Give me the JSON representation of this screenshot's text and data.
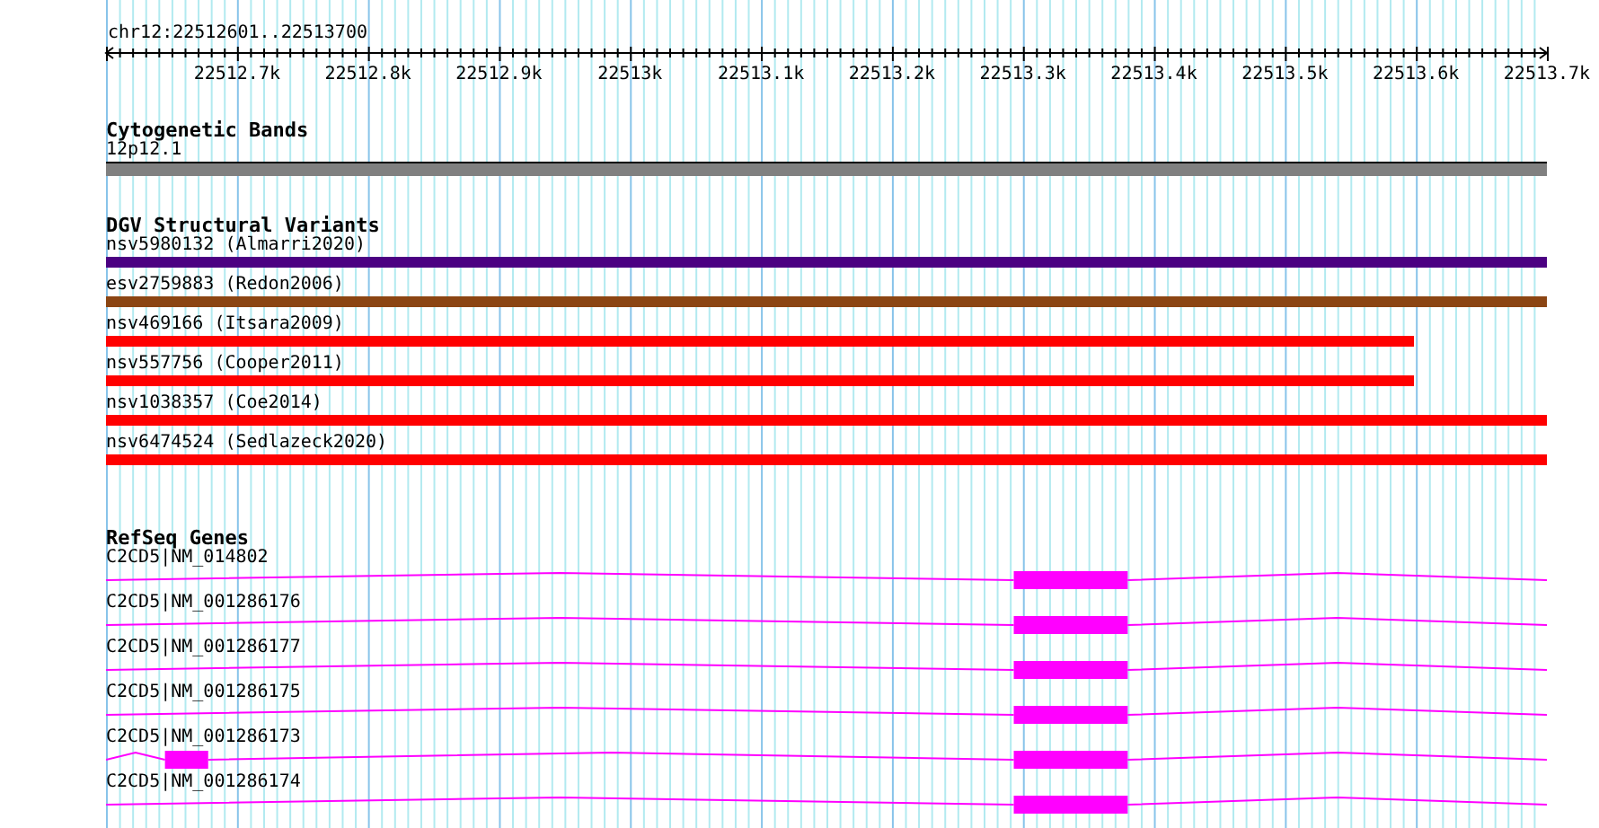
{
  "view": {
    "location": "chr12:22512601..22513700"
  },
  "ruler": {
    "ticks": [
      "22512.7k",
      "22512.8k",
      "22512.9k",
      "22513k",
      "22513.1k",
      "22513.2k",
      "22513.3k",
      "22513.4k",
      "22513.5k",
      "22513.6k",
      "22513.7k"
    ]
  },
  "cytoband_track": {
    "title": "Cytogenetic Bands",
    "band": "12p12.1"
  },
  "variant_track": {
    "title": "DGV Structural Variants",
    "variants": [
      {
        "label": "nsv5980132 (Almarri2020)",
        "color": "#4b0082",
        "extends_past_view": true
      },
      {
        "label": "esv2759883 (Redon2006)",
        "color": "#8b4513",
        "extends_past_view": true
      },
      {
        "label": "nsv469166 (Itsara2009)",
        "color": "#ff0000",
        "extends_past_view": false
      },
      {
        "label": "nsv557756 (Cooper2011)",
        "color": "#ff0000",
        "extends_past_view": false
      },
      {
        "label": "nsv1038357 (Coe2014)",
        "color": "#ff0000",
        "extends_past_view": true
      },
      {
        "label": "nsv6474524 (Sedlazeck2020)",
        "color": "#ff0000",
        "extends_past_view": true
      }
    ]
  },
  "gene_track": {
    "title": "RefSeq Genes",
    "genes": [
      {
        "label": "C2CD5|NM_014802",
        "kind": "single"
      },
      {
        "label": "C2CD5|NM_001286176",
        "kind": "single"
      },
      {
        "label": "C2CD5|NM_001286177",
        "kind": "single"
      },
      {
        "label": "C2CD5|NM_001286175",
        "kind": "single"
      },
      {
        "label": "C2CD5|NM_001286173",
        "kind": "double"
      },
      {
        "label": "C2CD5|NM_001286174",
        "kind": "single"
      }
    ]
  }
}
